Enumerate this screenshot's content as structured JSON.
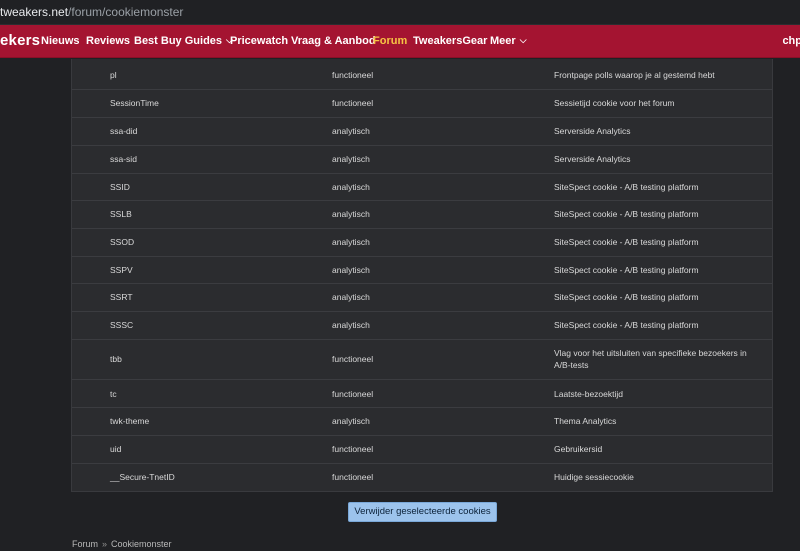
{
  "browser": {
    "url_host": "tweakers.net",
    "url_path": "/forum/cookiemonster"
  },
  "nav": {
    "logo": "ekers",
    "items": [
      {
        "label": "Nieuws",
        "dropdown": false,
        "active": false
      },
      {
        "label": "Reviews",
        "dropdown": false,
        "active": false
      },
      {
        "label": "Best Buy Guides",
        "dropdown": true,
        "active": false
      },
      {
        "label": "Pricewatch",
        "dropdown": false,
        "active": false
      },
      {
        "label": "Vraag & Aanbod",
        "dropdown": false,
        "active": false
      },
      {
        "label": "Forum",
        "dropdown": false,
        "active": true
      },
      {
        "label": "TweakersGear",
        "dropdown": false,
        "active": false
      },
      {
        "label": "Meer",
        "dropdown": true,
        "active": false
      }
    ],
    "user": "chp",
    "accent_color": "#a41431",
    "active_color": "#f6c544"
  },
  "cookies": [
    {
      "name": "pl",
      "type": "functioneel",
      "description": "Frontpage polls waarop je al gestemd hebt"
    },
    {
      "name": "SessionTime",
      "type": "functioneel",
      "description": "Sessietijd cookie voor het forum"
    },
    {
      "name": "ssa-did",
      "type": "analytisch",
      "description": "Serverside Analytics"
    },
    {
      "name": "ssa-sid",
      "type": "analytisch",
      "description": "Serverside Analytics"
    },
    {
      "name": "SSID",
      "type": "analytisch",
      "description": "SiteSpect cookie - A/B testing platform"
    },
    {
      "name": "SSLB",
      "type": "analytisch",
      "description": "SiteSpect cookie - A/B testing platform"
    },
    {
      "name": "SSOD",
      "type": "analytisch",
      "description": "SiteSpect cookie - A/B testing platform"
    },
    {
      "name": "SSPV",
      "type": "analytisch",
      "description": "SiteSpect cookie - A/B testing platform"
    },
    {
      "name": "SSRT",
      "type": "analytisch",
      "description": "SiteSpect cookie - A/B testing platform"
    },
    {
      "name": "SSSC",
      "type": "analytisch",
      "description": "SiteSpect cookie - A/B testing platform"
    },
    {
      "name": "tbb",
      "type": "functioneel",
      "description": "Vlag voor het uitsluiten van specifieke bezoekers in A/B-tests"
    },
    {
      "name": "tc",
      "type": "functioneel",
      "description": "Laatste-bezoektijd"
    },
    {
      "name": "twk-theme",
      "type": "analytisch",
      "description": "Thema Analytics"
    },
    {
      "name": "uid",
      "type": "functioneel",
      "description": "Gebruikersid"
    },
    {
      "name": "__Secure-TnetID",
      "type": "functioneel",
      "description": "Huidige sessiecookie"
    }
  ],
  "delete_button": "Verwijder geselecteerde cookies",
  "breadcrumb": [
    "Forum",
    "Cookiemonster"
  ],
  "breadcrumb_separator": "»"
}
